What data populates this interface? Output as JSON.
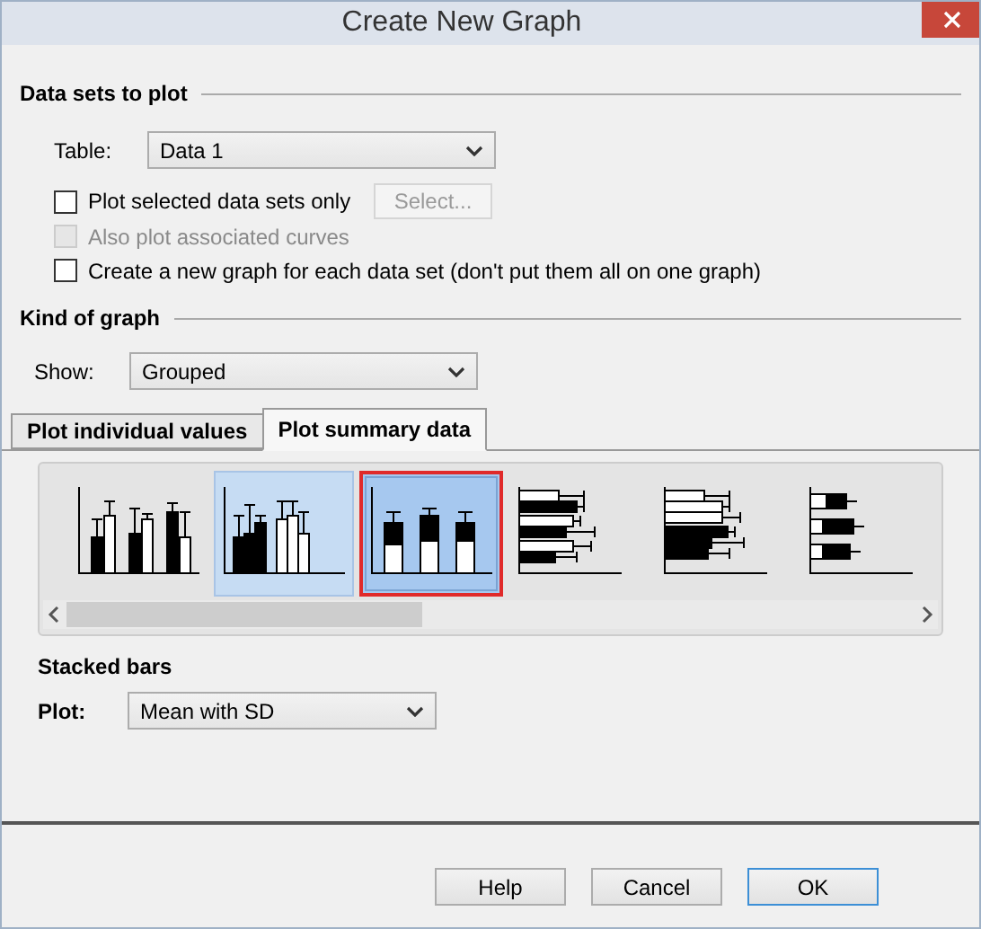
{
  "window": {
    "title": "Create New Graph"
  },
  "data_sets": {
    "heading": "Data sets to plot",
    "table_label": "Table:",
    "table_value": "Data 1",
    "options": [
      {
        "label": "Plot selected data sets only",
        "checked": false,
        "disabled": false
      },
      {
        "label": "Also plot associated curves",
        "checked": false,
        "disabled": true
      },
      {
        "label": "Create a new graph for each data set (don't put them all on one graph)",
        "checked": false,
        "disabled": false
      }
    ],
    "select_button": {
      "label": "Select...",
      "disabled": true
    }
  },
  "kind_of_graph": {
    "heading": "Kind of graph",
    "show_label": "Show:",
    "show_value": "Grouped"
  },
  "tabs": [
    {
      "label": "Plot individual values",
      "selected": false
    },
    {
      "label": "Plot summary data",
      "selected": true
    }
  ],
  "gallery": [
    {
      "kind": "grouped-vertical",
      "selected": false,
      "hovered": false
    },
    {
      "kind": "adjacent-vertical",
      "selected": false,
      "hovered": true
    },
    {
      "kind": "stacked-vertical",
      "selected": true,
      "hovered": false
    },
    {
      "kind": "grouped-horizontal",
      "selected": false,
      "hovered": false
    },
    {
      "kind": "adjacent-horizontal",
      "selected": false,
      "hovered": false
    },
    {
      "kind": "stacked-horizontal",
      "selected": false,
      "hovered": false
    }
  ],
  "graph_name": "Stacked bars",
  "plot_label": "Plot:",
  "plot_value": "Mean with SD",
  "buttons": [
    "Help",
    "Cancel",
    "OK"
  ]
}
